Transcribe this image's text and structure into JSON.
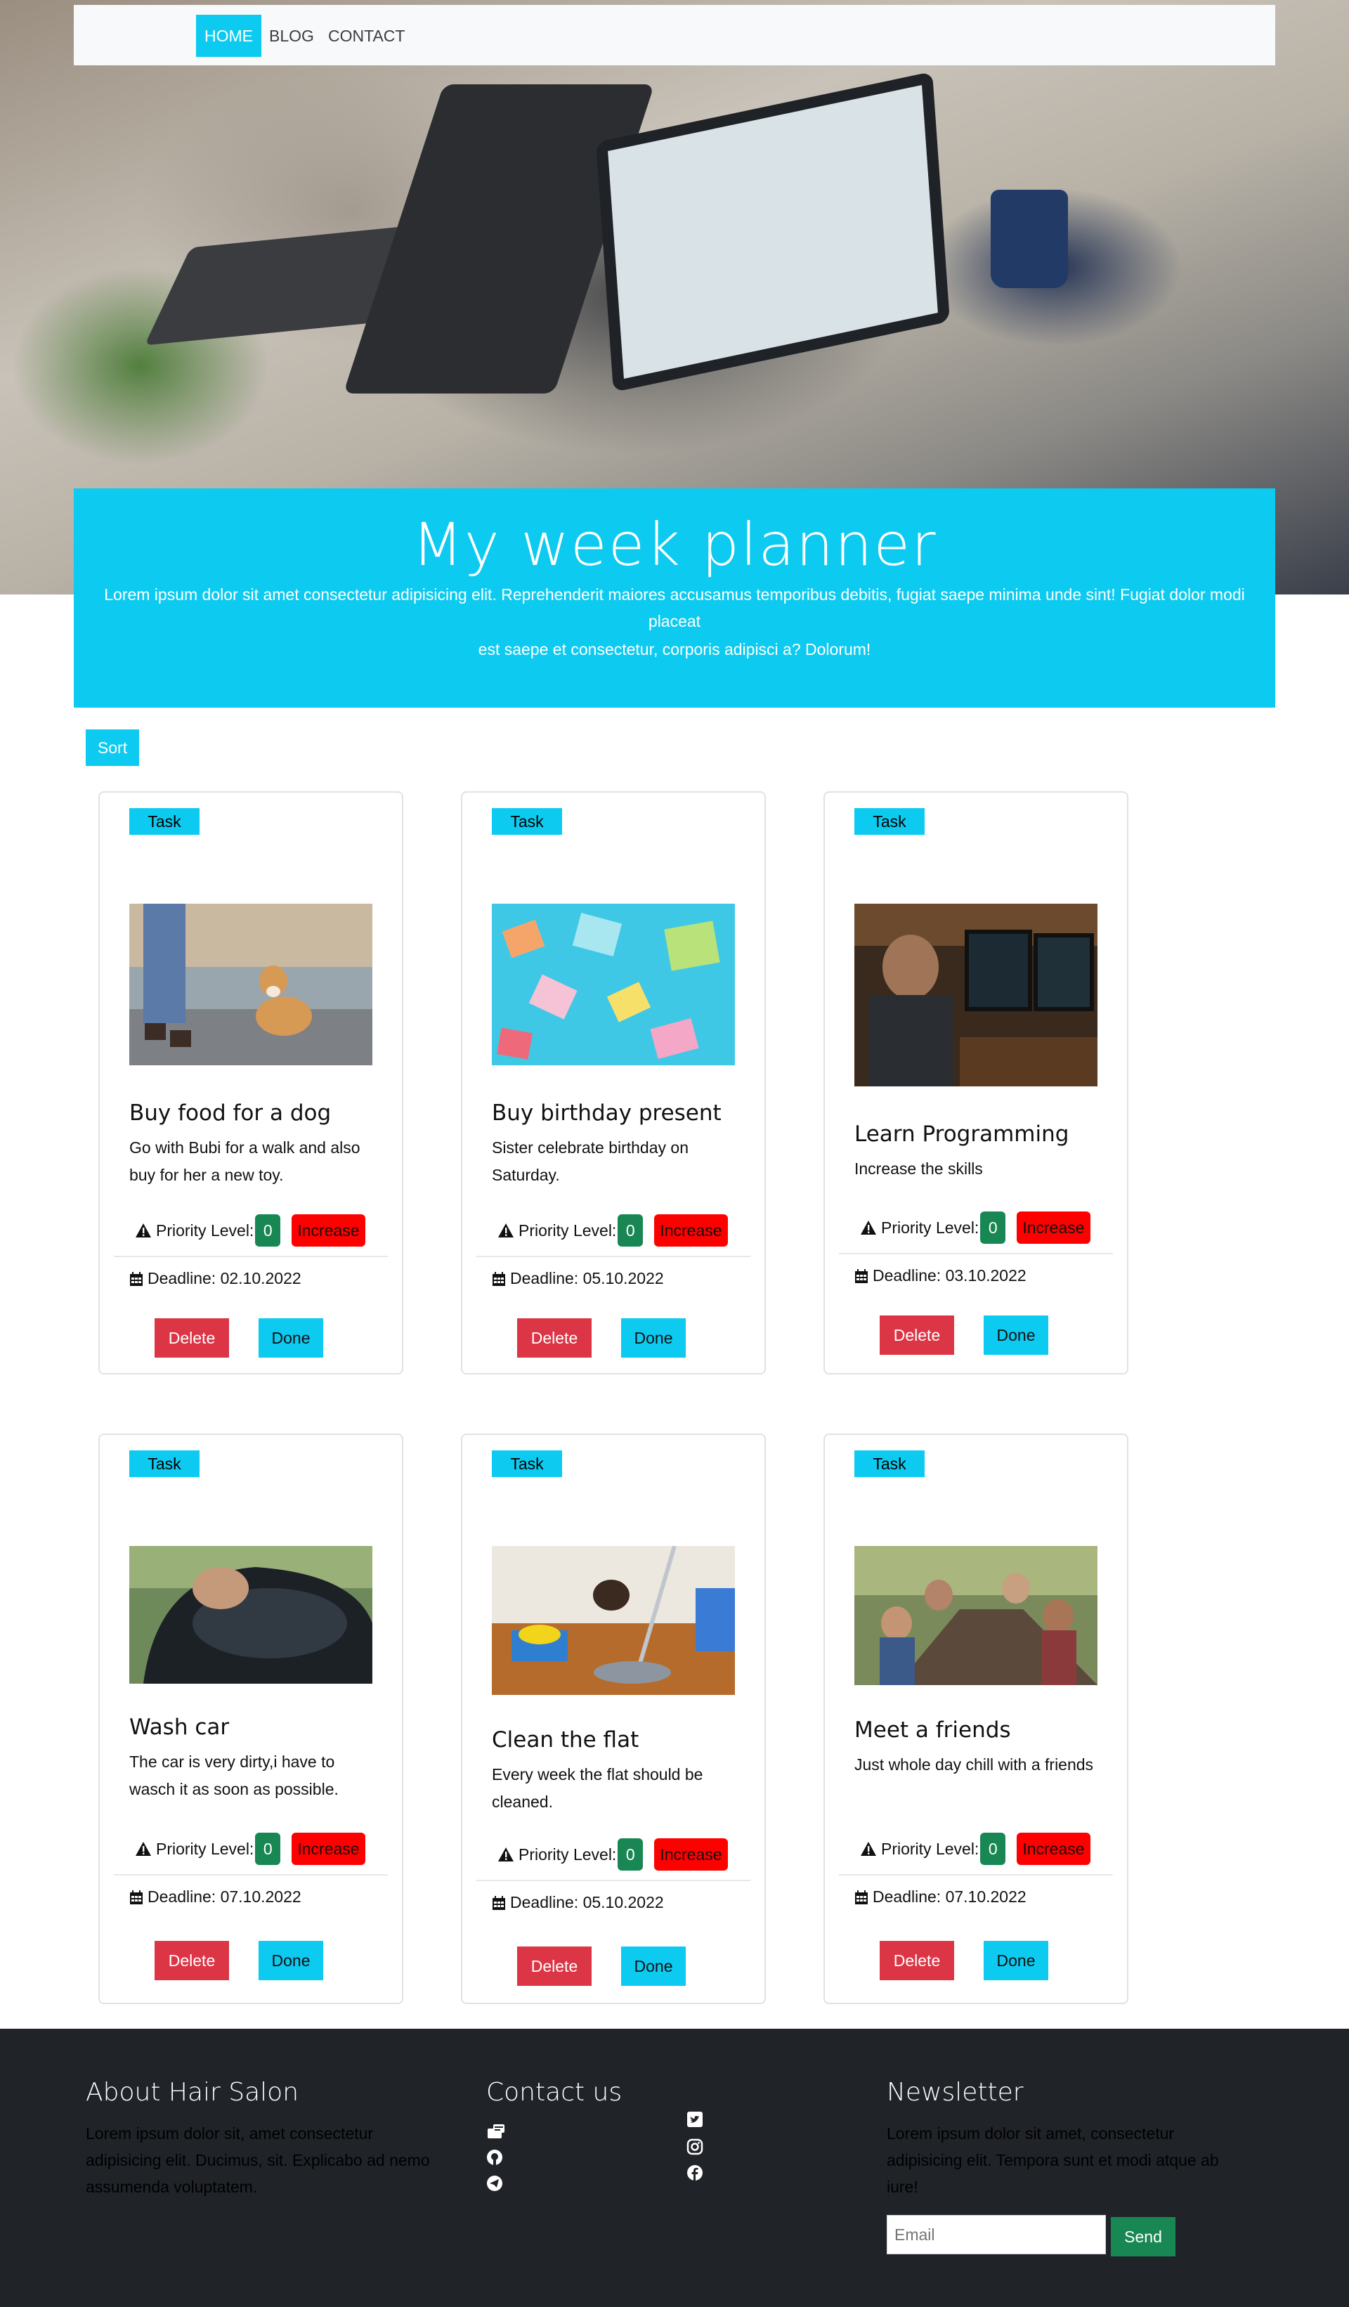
{
  "nav": {
    "items": [
      {
        "label": "HOME",
        "active": true
      },
      {
        "label": "BLOG",
        "active": false
      },
      {
        "label": "CONTACT",
        "active": false
      }
    ]
  },
  "banner": {
    "title": "My week planner",
    "line1": "Lorem ipsum dolor sit amet consectetur adipisicing elit. Reprehenderit maiores accusamus temporibus debitis, fugiat saepe minima unde sint! Fugiat dolor modi placeat",
    "line2": "est saepe et consectetur, corporis adipisci a? Dolorum!"
  },
  "sort_label": "Sort",
  "tasks": [
    {
      "badge": "Task",
      "image": "dog-walk-photo",
      "title": "Buy food for a dog",
      "text": "Go with Bubi for a walk and also buy for her a new toy.",
      "priority_label": "Priority Level:",
      "priority": 0,
      "increase_label": "Increase",
      "deadline": "Deadline: 02.10.2022",
      "delete_label": "Delete",
      "done_label": "Done"
    },
    {
      "badge": "Task",
      "image": "gift-boxes-photo",
      "title": "Buy birthday present",
      "text": "Sister celebrate birthday on Saturday.",
      "priority_label": "Priority Level:",
      "priority": 0,
      "increase_label": "Increase",
      "deadline": "Deadline: 05.10.2022",
      "delete_label": "Delete",
      "done_label": "Done"
    },
    {
      "badge": "Task",
      "image": "programmer-photo",
      "title": "Learn Programming",
      "text": "Increase the skills",
      "priority_label": "Priority Level:",
      "priority": 0,
      "increase_label": "Increase",
      "deadline": "Deadline: 03.10.2022",
      "delete_label": "Delete",
      "done_label": "Done"
    },
    {
      "badge": "Task",
      "image": "car-wash-photo",
      "title": "Wash car",
      "text": "The car is very dirty,i have to wasch it as soon as possible.",
      "priority_label": "Priority Level:",
      "priority": 0,
      "increase_label": "Increase",
      "deadline": "Deadline: 07.10.2022",
      "delete_label": "Delete",
      "done_label": "Done"
    },
    {
      "badge": "Task",
      "image": "cleaning-photo",
      "title": "Clean the flat",
      "text": "Every week the flat should be cleaned.",
      "priority_label": "Priority Level:",
      "priority": 0,
      "increase_label": "Increase",
      "deadline": "Deadline: 05.10.2022",
      "delete_label": "Delete",
      "done_label": "Done"
    },
    {
      "badge": "Task",
      "image": "friends-dinner-photo",
      "title": "Meet a friends",
      "text": "Just whole day chill with a friends",
      "priority_label": "Priority Level:",
      "priority": 0,
      "increase_label": "Increase",
      "deadline": "Deadline: 07.10.2022",
      "delete_label": "Delete",
      "done_label": "Done"
    }
  ],
  "footer": {
    "about_title": "About Hair Salon",
    "about_text": "Lorem ipsum dolor sit, amet consectetur adipisicing elit. Ducimus, sit. Explicabo ad nemo assumenda voluptatem.",
    "contact_title": "Contact us",
    "contact_icons": [
      "contact-card-icon",
      "github-icon",
      "telegram-icon",
      "twitter-icon",
      "instagram-icon",
      "facebook-icon"
    ],
    "newsletter_title": "Newsletter",
    "newsletter_text": "Lorem ipsum dolor sit amet, consectetur adipisicing elit. Tempora sunt et modi atque ab iure!",
    "email_placeholder": "Email",
    "send_label": "Send"
  },
  "colors": {
    "accent": "#0dcaf0",
    "danger": "#dc3545",
    "success": "#198754",
    "increase": "#ff0000",
    "footer_bg": "#202328"
  }
}
